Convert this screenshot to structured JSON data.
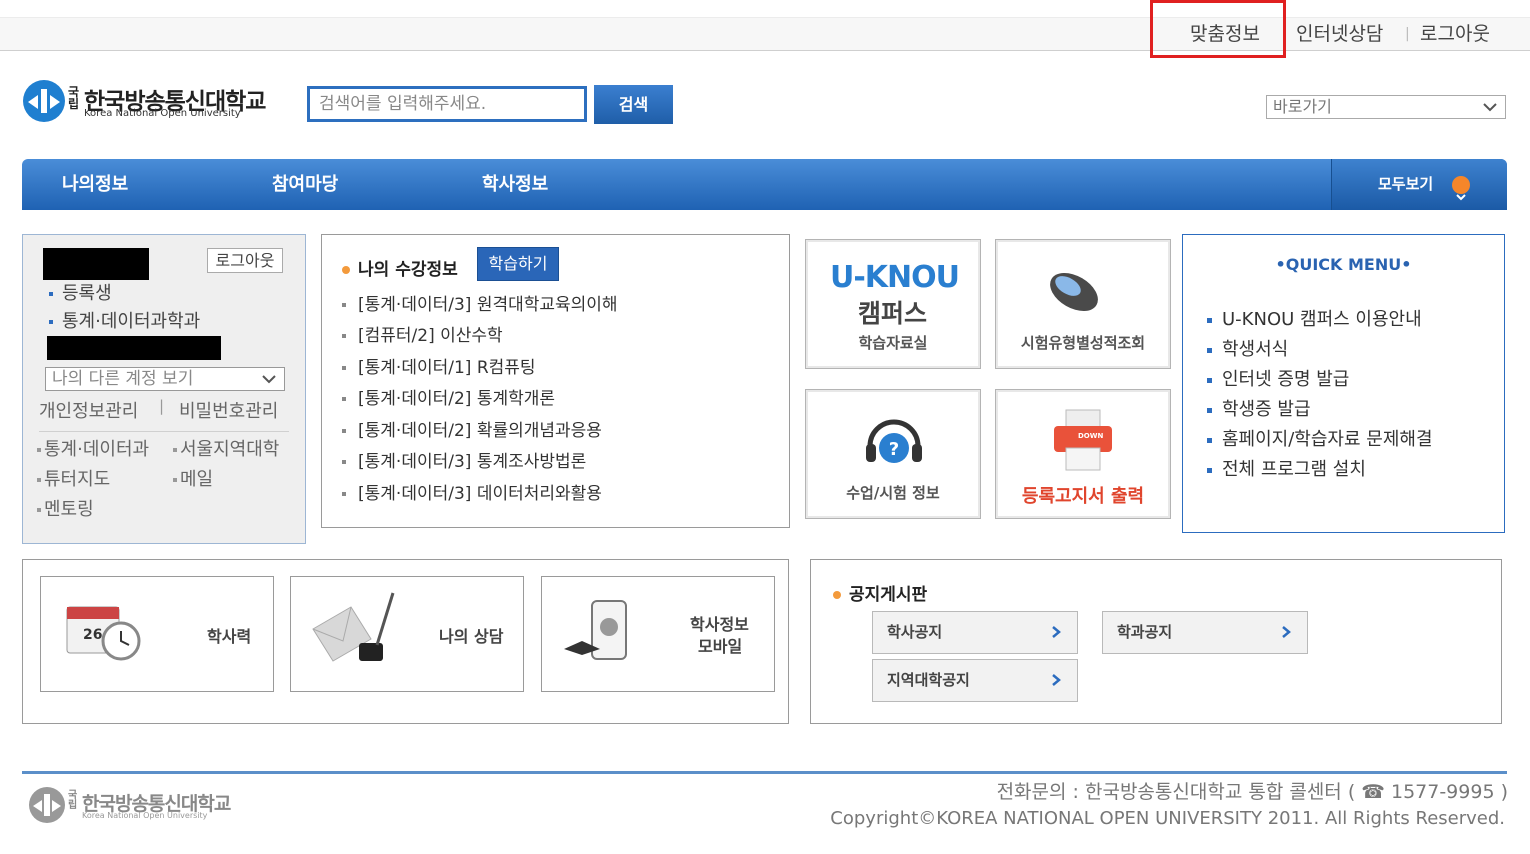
{
  "topbar": {
    "links": [
      "맞춤정보",
      "인터넷상담",
      "로그아웃"
    ]
  },
  "header": {
    "logo_text_ko": "한국방송통신대학교",
    "logo_text_side": "국립",
    "logo_text_en": "Korea National Open University",
    "search_placeholder": "검색어를 입력해주세요.",
    "search_button": "검색",
    "quick_select": "바로가기"
  },
  "nav": {
    "items": [
      "나의정보",
      "참여마당",
      "학사정보"
    ],
    "all_label": "모두보기"
  },
  "profile": {
    "logout_label": "로그아웃",
    "status": "등록생",
    "department": "통계·데이터과학과",
    "account_select": "나의 다른 계정 보기",
    "link_personal": "개인정보관리",
    "link_separator": "|",
    "link_password": "비밀번호관리",
    "links": [
      "통계·데이터과",
      "서울지역대학",
      "튜터지도",
      "메일",
      "멘토링"
    ]
  },
  "course": {
    "title": "나의 수강정보",
    "study_button": "학습하기",
    "items": [
      "[통계·데이터/3] 원격대학교육의이해",
      "[컴퓨터/2] 이산수학",
      "[통계·데이터/1] R컴퓨팅",
      "[통계·데이터/2] 통계학개론",
      "[통계·데이터/2] 확률의개념과응용",
      "[통계·데이터/3] 통계조사방법론",
      "[통계·데이터/3] 데이터처리와활용"
    ]
  },
  "tiles": {
    "uknou_logo": "U-KNOU",
    "uknou_campus": "캠퍼스",
    "uknou_label": "학습자료실",
    "exam_label": "시험유형별성적조회",
    "class_label": "수업/시험 정보",
    "print_label": "등록고지서 출력",
    "print_tag": "DOWN"
  },
  "quickmenu": {
    "title": "QUICK MENU",
    "items": [
      "U-KNOU 캠퍼스 이용안내",
      "학생서식",
      "인터넷 증명 발급",
      "학생증 발급",
      "홈페이지/학습자료 문제해결",
      "전체 프로그램 설치"
    ]
  },
  "links_box": {
    "calendar": "학사력",
    "calendar_day": "26",
    "consult": "나의 상담",
    "mobile_line1": "학사정보",
    "mobile_line2": "모바일"
  },
  "notice": {
    "title": "공지게시판",
    "buttons": [
      "학사공지",
      "학과공지",
      "지역대학공지"
    ]
  },
  "footer": {
    "phone": "전화문의 : 한국방송통신대학교 통합 콜센터 ( ☎ 1577-9995 )",
    "copyright": "Copyright©KOREA NATIONAL OPEN UNIVERSITY 2011. All Rights Reserved."
  },
  "colors": {
    "brand_blue": "#1f62b3",
    "accent_orange": "#f39a3c",
    "highlight_red": "#e02020"
  }
}
